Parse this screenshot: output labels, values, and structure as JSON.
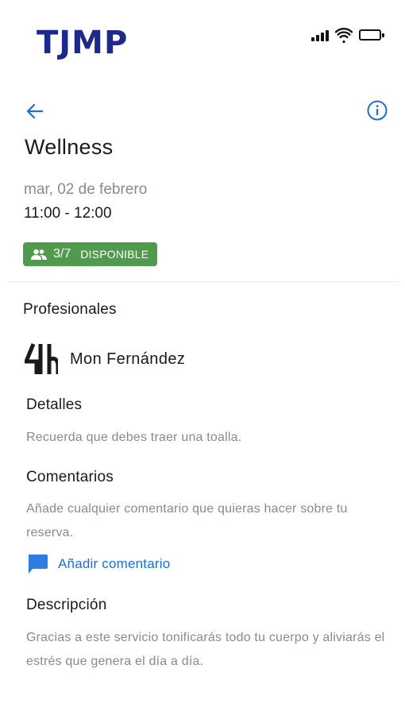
{
  "brand": {
    "logo_text": "TJMP",
    "logo_color": "#1d2a8a"
  },
  "status_bar": {
    "icons": [
      "signal-icon",
      "wifi-icon",
      "battery-icon"
    ]
  },
  "header": {
    "back_icon": "arrow-left-icon",
    "info_icon": "info-icon",
    "accent_color": "#1a6fd8"
  },
  "session": {
    "title": "Wellness",
    "date": "mar, 02 de febrero",
    "time": "11:00 - 12:00",
    "availability": {
      "icon": "people-icon",
      "count": "3/7",
      "status": "DISPONIBLE",
      "color": "#4f9a4d"
    }
  },
  "professionals": {
    "heading": "Profesionales",
    "items": [
      {
        "name": "Mon Fernández",
        "logo_icon": "professional-logo-icon"
      }
    ]
  },
  "details": {
    "heading": "Detalles",
    "text": "Recuerda que debes traer una toalla."
  },
  "comments": {
    "heading": "Comentarios",
    "text": "Añade cualquier comentario que quieras hacer sobre tu reserva.",
    "add_label": "Añadir comentario",
    "add_icon": "comment-icon"
  },
  "description": {
    "heading": "Descripción",
    "text": "Gracias a este servicio tonificarás todo tu cuerpo y aliviarás el estrés que genera el día a día."
  }
}
